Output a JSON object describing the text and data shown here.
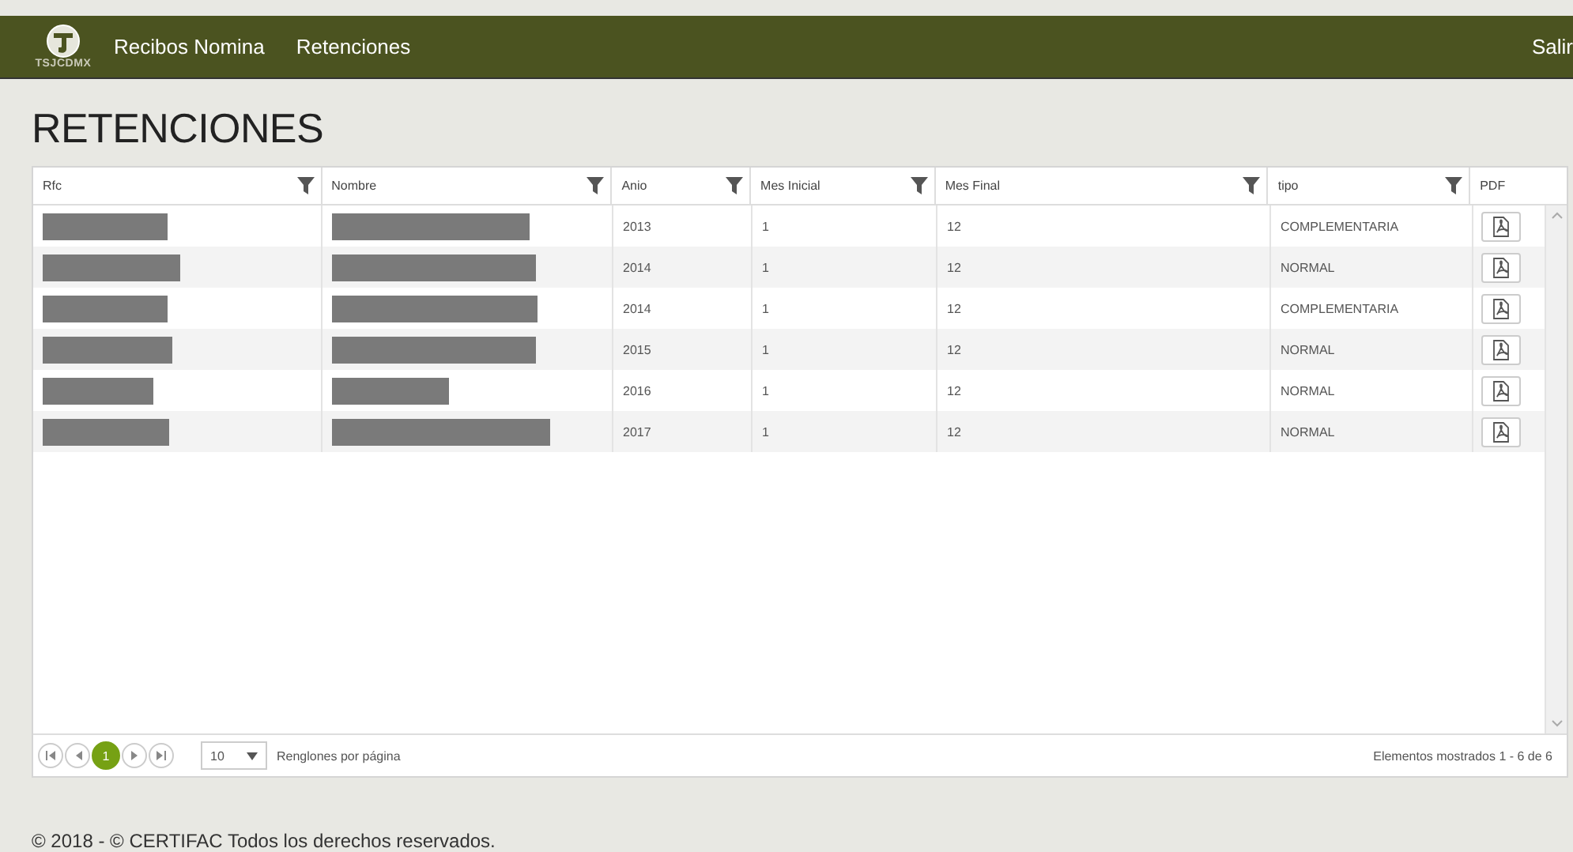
{
  "navbar": {
    "logo_text": "TSJCDMX",
    "links": [
      {
        "label": "Recibos Nomina"
      },
      {
        "label": "Retenciones"
      }
    ],
    "logout": "Salir"
  },
  "page_title": "RETENCIONES",
  "table": {
    "columns": [
      {
        "label": "Rfc",
        "filter": true
      },
      {
        "label": "Nombre",
        "filter": true
      },
      {
        "label": "Anio",
        "filter": true
      },
      {
        "label": "Mes Inicial",
        "filter": true
      },
      {
        "label": "Mes Final",
        "filter": true
      },
      {
        "label": "tipo",
        "filter": true
      },
      {
        "label": "PDF",
        "filter": false
      }
    ],
    "rows": [
      {
        "redacted": true,
        "anio": "2013",
        "mes_inicial": "1",
        "mes_final": "12",
        "tipo": "COMPLEMENTARIA"
      },
      {
        "redacted": true,
        "anio": "2014",
        "mes_inicial": "1",
        "mes_final": "12",
        "tipo": "NORMAL"
      },
      {
        "redacted": true,
        "anio": "2014",
        "mes_inicial": "1",
        "mes_final": "12",
        "tipo": "COMPLEMENTARIA"
      },
      {
        "redacted": true,
        "anio": "2015",
        "mes_inicial": "1",
        "mes_final": "12",
        "tipo": "NORMAL"
      },
      {
        "redacted": true,
        "anio": "2016",
        "mes_inicial": "1",
        "mes_final": "12",
        "tipo": "NORMAL"
      },
      {
        "redacted": true,
        "anio": "2017",
        "mes_inicial": "1",
        "mes_final": "12",
        "tipo": "NORMAL"
      }
    ]
  },
  "pager": {
    "pages": [
      {
        "label": "1",
        "selected": true
      }
    ],
    "page_size": "10",
    "page_size_label": "Renglones por página",
    "summary": "Elementos mostrados 1 - 6 de 6"
  },
  "footer": "© 2018 - © CERTIFAC Todos los derechos reservados."
}
